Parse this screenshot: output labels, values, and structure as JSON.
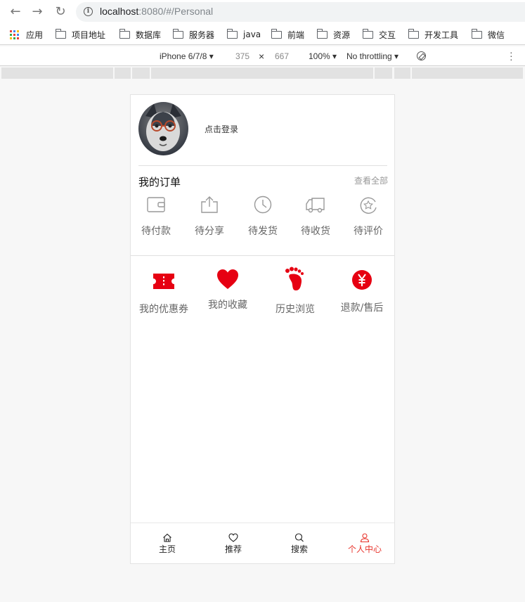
{
  "browser": {
    "url_host": "localhost",
    "url_rest": ":8080/#/Personal",
    "bookmarks": [
      "应用",
      "项目地址",
      "数据库",
      "服务器",
      "java",
      "前端",
      "资源",
      "交互",
      "开发工具",
      "微信"
    ]
  },
  "devtools": {
    "device": "iPhone 6/7/8 ▾",
    "width": "375",
    "times": "×",
    "height": "667",
    "zoom": "100% ▾",
    "throttle": "No throttling ▾"
  },
  "profile": {
    "login_text": "点击登录"
  },
  "orders": {
    "title": "我的订单",
    "view_all": "查看全部",
    "items": [
      {
        "label": "待付款",
        "icon": "wallet-icon"
      },
      {
        "label": "待分享",
        "icon": "share-icon"
      },
      {
        "label": "待发货",
        "icon": "clock-icon"
      },
      {
        "label": "待收货",
        "icon": "truck-icon"
      },
      {
        "label": "待评价",
        "icon": "star-review-icon"
      }
    ]
  },
  "services": {
    "items": [
      {
        "label": "我的优惠券",
        "icon": "coupon-icon"
      },
      {
        "label": "我的收藏",
        "icon": "heart-icon"
      },
      {
        "label": "历史浏览",
        "icon": "footprint-icon"
      },
      {
        "label": "退款/售后",
        "icon": "yen-icon"
      }
    ]
  },
  "tabbar": {
    "items": [
      {
        "label": "主页",
        "icon": "home-icon"
      },
      {
        "label": "推荐",
        "icon": "heart-outline-icon"
      },
      {
        "label": "搜索",
        "icon": "search-icon"
      },
      {
        "label": "个人中心",
        "icon": "user-icon"
      }
    ],
    "active": 3
  },
  "colors": {
    "accent": "#e8332b",
    "icon_red": "#e60012",
    "icon_gray": "#999999"
  }
}
